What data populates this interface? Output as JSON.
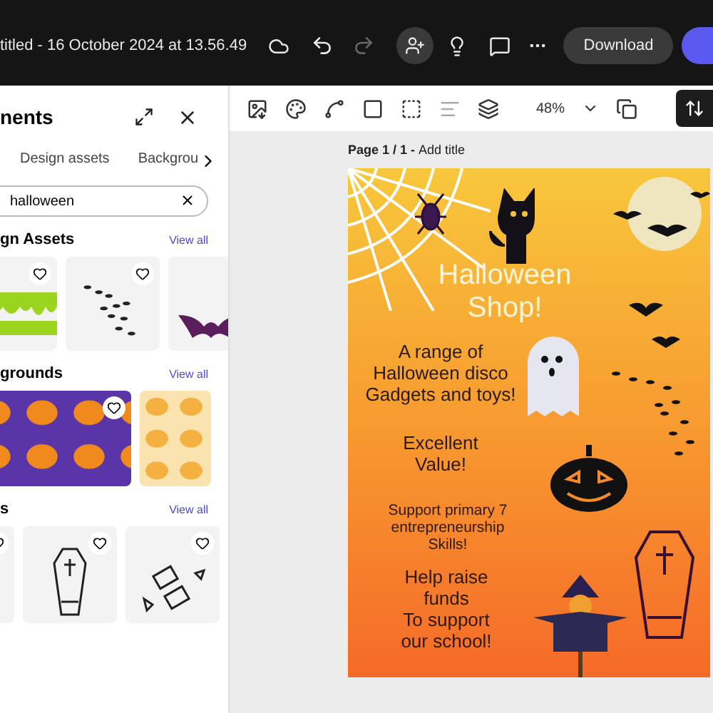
{
  "top_bar": {
    "file_title": "titled - 16 October 2024 at 13.56.49",
    "download_label": "Download"
  },
  "panel": {
    "title": "nents",
    "tabs": [
      {
        "label": "Design assets",
        "selected": false
      },
      {
        "label": "Backgrou",
        "selected": false
      }
    ],
    "search": {
      "value": "halloween"
    },
    "sections": [
      {
        "title": "gn Assets",
        "link": "View all",
        "tiles": [
          {
            "kind": "slime"
          },
          {
            "kind": "bats"
          },
          {
            "kind": "bat"
          }
        ]
      },
      {
        "title": "grounds",
        "link": "View all",
        "tiles": [
          {
            "kind": "pumpkins"
          },
          {
            "kind": "faces"
          }
        ]
      },
      {
        "title": "s",
        "link": "View all",
        "tiles": [
          {
            "kind": "blank"
          },
          {
            "kind": "coffin"
          },
          {
            "kind": "candy"
          }
        ]
      }
    ]
  },
  "toolbar": {
    "zoom": "48%"
  },
  "canvas": {
    "page_label": "Page 1 / 1 - ",
    "title_placeholder": "Add title"
  },
  "poster": {
    "headline": "Halloween\nShop!",
    "texts": [
      "A range of\nHalloween disco\nGadgets and toys!",
      "Excellent\nValue!",
      "Support primary 7\nentrepreneurship\nSkills!",
      "Help raise\nfunds\nTo support\nour school!"
    ]
  }
}
